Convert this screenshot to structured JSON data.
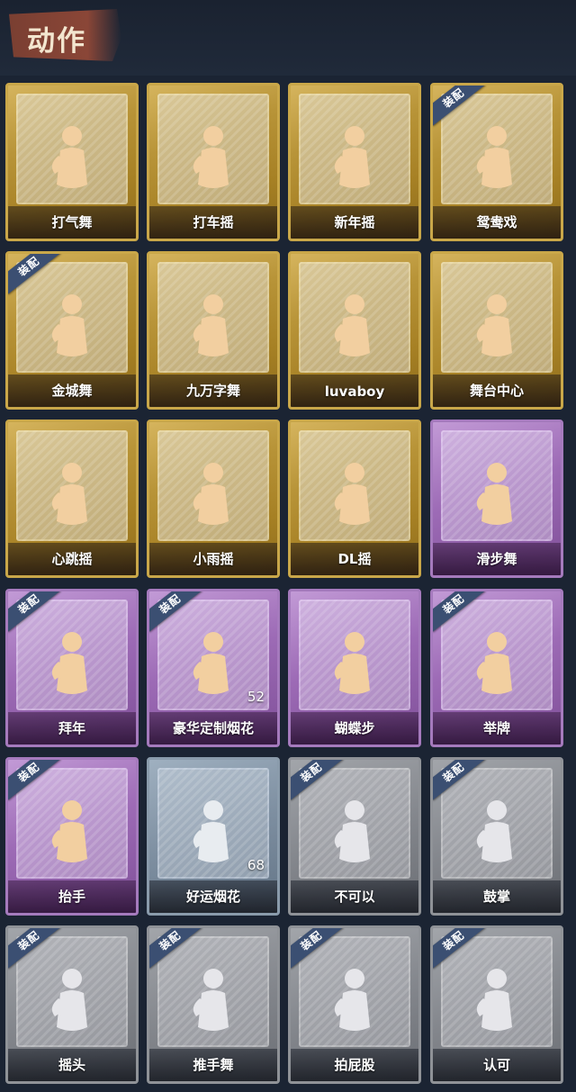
{
  "header": {
    "title": "动作"
  },
  "cards": [
    {
      "label": "打气舞",
      "tier": "gold",
      "equipped": false,
      "count": null
    },
    {
      "label": "打车摇",
      "tier": "gold",
      "equipped": false,
      "count": null
    },
    {
      "label": "新年摇",
      "tier": "gold",
      "equipped": false,
      "count": null
    },
    {
      "label": "鸳鸯戏",
      "tier": "gold",
      "equipped": true,
      "count": null
    },
    {
      "label": "金城舞",
      "tier": "gold",
      "equipped": true,
      "count": null
    },
    {
      "label": "九万字舞",
      "tier": "gold",
      "equipped": false,
      "count": null
    },
    {
      "label": "luvaboy",
      "tier": "gold",
      "equipped": false,
      "count": null
    },
    {
      "label": "舞台中心",
      "tier": "gold",
      "equipped": false,
      "count": null
    },
    {
      "label": "心跳摇",
      "tier": "gold",
      "equipped": false,
      "count": null
    },
    {
      "label": "小雨摇",
      "tier": "gold",
      "equipped": false,
      "count": null
    },
    {
      "label": "DL摇",
      "tier": "gold",
      "equipped": false,
      "count": null
    },
    {
      "label": "滑步舞",
      "tier": "purple",
      "equipped": false,
      "count": null
    },
    {
      "label": "拜年",
      "tier": "purple",
      "equipped": true,
      "count": null
    },
    {
      "label": "豪华定制烟花",
      "tier": "purple",
      "equipped": true,
      "count": "52"
    },
    {
      "label": "蝴蝶步",
      "tier": "purple",
      "equipped": false,
      "count": null
    },
    {
      "label": "举牌",
      "tier": "purple",
      "equipped": true,
      "count": null
    },
    {
      "label": "抬手",
      "tier": "purple",
      "equipped": true,
      "count": null
    },
    {
      "label": "好运烟花",
      "tier": "blue",
      "equipped": false,
      "count": "68"
    },
    {
      "label": "不可以",
      "tier": "gray",
      "equipped": true,
      "count": null
    },
    {
      "label": "鼓掌",
      "tier": "gray",
      "equipped": true,
      "count": null
    },
    {
      "label": "摇头",
      "tier": "gray",
      "equipped": true,
      "count": null
    },
    {
      "label": "推手舞",
      "tier": "gray",
      "equipped": true,
      "count": null
    },
    {
      "label": "拍屁股",
      "tier": "gray",
      "equipped": true,
      "count": null
    },
    {
      "label": "认可",
      "tier": "gray",
      "equipped": true,
      "count": null
    }
  ],
  "equip_badge_text": "装配",
  "colors": {
    "background": "#1b2433",
    "header_banner": "#8a4637",
    "gold": "#b89438",
    "purple": "#9d6bb6",
    "blue": "#7d8ea0",
    "gray": "#84878d",
    "equip_badge": "#3b4f72"
  }
}
